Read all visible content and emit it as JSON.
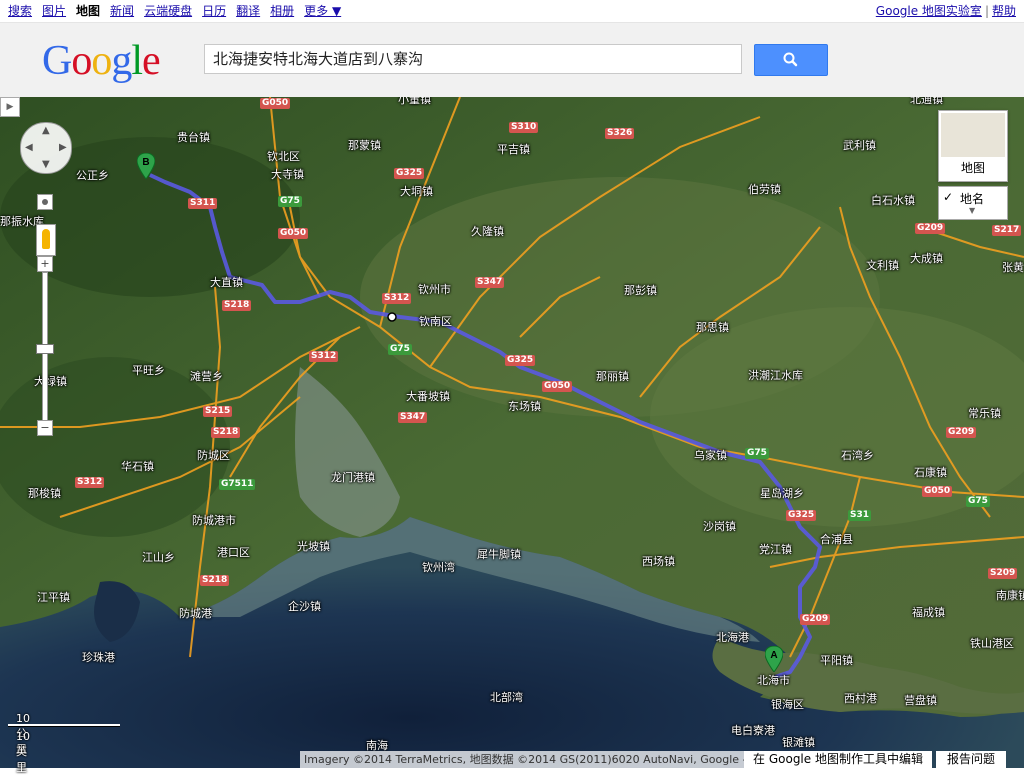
{
  "topbar": {
    "nav": [
      "搜索",
      "图片",
      "地图",
      "新闻",
      "云端硬盘",
      "日历",
      "翻译",
      "相册",
      "更多 ▼"
    ],
    "active_index": 2,
    "right_links": [
      "Google 地图实验室",
      "帮助"
    ]
  },
  "header": {
    "logo": {
      "letters": [
        "G",
        "o",
        "o",
        "g",
        "l",
        "e"
      ]
    },
    "search_value": "北海捷安特北海大道店到八寨沟",
    "search_icon": "search-icon"
  },
  "map": {
    "place_labels": [
      {
        "text": "贵台镇"
      },
      {
        "text": "公正乡"
      },
      {
        "text": "钦北区"
      },
      {
        "text": "大寺镇"
      },
      {
        "text": "那蒙镇"
      },
      {
        "text": "大垌镇"
      },
      {
        "text": "平吉镇"
      },
      {
        "text": "伯劳镇"
      },
      {
        "text": "武利镇"
      },
      {
        "text": "白石水镇"
      },
      {
        "text": "久隆镇"
      },
      {
        "text": "文利镇"
      },
      {
        "text": "大成镇"
      },
      {
        "text": "大直镇"
      },
      {
        "text": "钦州市"
      },
      {
        "text": "钦南区"
      },
      {
        "text": "那彭镇"
      },
      {
        "text": "那思镇"
      },
      {
        "text": "平旺乡"
      },
      {
        "text": "滩营乡"
      },
      {
        "text": "大绿镇"
      },
      {
        "text": "大番坡镇"
      },
      {
        "text": "那丽镇"
      },
      {
        "text": "洪潮江水库"
      },
      {
        "text": "东场镇"
      },
      {
        "text": "常乐镇"
      },
      {
        "text": "防城区"
      },
      {
        "text": "乌家镇"
      },
      {
        "text": "石湾乡"
      },
      {
        "text": "华石镇"
      },
      {
        "text": "龙门港镇"
      },
      {
        "text": "石康镇"
      },
      {
        "text": "那梭镇"
      },
      {
        "text": "星岛湖乡"
      },
      {
        "text": "防城港市"
      },
      {
        "text": "沙岗镇"
      },
      {
        "text": "合浦县"
      },
      {
        "text": "光坡镇"
      },
      {
        "text": "港口区"
      },
      {
        "text": "犀牛脚镇"
      },
      {
        "text": "党江镇"
      },
      {
        "text": "江山乡"
      },
      {
        "text": "钦州湾"
      },
      {
        "text": "西场镇"
      },
      {
        "text": "江平镇"
      },
      {
        "text": "防城港"
      },
      {
        "text": "企沙镇"
      },
      {
        "text": "福成镇"
      },
      {
        "text": "南康镇"
      },
      {
        "text": "北海港"
      },
      {
        "text": "铁山港区"
      },
      {
        "text": "珍珠港"
      },
      {
        "text": "平阳镇"
      },
      {
        "text": "北海市"
      },
      {
        "text": "西村港"
      },
      {
        "text": "营盘镇"
      },
      {
        "text": "北部湾"
      },
      {
        "text": "银海区"
      },
      {
        "text": "电白寮港"
      },
      {
        "text": "银滩镇"
      },
      {
        "text": "南海"
      },
      {
        "text": "那振水库"
      },
      {
        "text": "张黄"
      },
      {
        "text": "小董镇"
      },
      {
        "text": "北通镇"
      }
    ],
    "road_shields": [
      {
        "text": "G050",
        "kind": "s"
      },
      {
        "text": "S310",
        "kind": "s"
      },
      {
        "text": "S326",
        "kind": "s"
      },
      {
        "text": "G325",
        "kind": "s"
      },
      {
        "text": "S311",
        "kind": "s"
      },
      {
        "text": "G75",
        "kind": "g"
      },
      {
        "text": "G050",
        "kind": "s"
      },
      {
        "text": "S347",
        "kind": "s"
      },
      {
        "text": "S312",
        "kind": "s"
      },
      {
        "text": "S218",
        "kind": "s"
      },
      {
        "text": "G75",
        "kind": "g"
      },
      {
        "text": "G325",
        "kind": "s"
      },
      {
        "text": "S312",
        "kind": "s"
      },
      {
        "text": "G050",
        "kind": "s"
      },
      {
        "text": "S347",
        "kind": "s"
      },
      {
        "text": "S215",
        "kind": "s"
      },
      {
        "text": "S218",
        "kind": "s"
      },
      {
        "text": "G75",
        "kind": "g"
      },
      {
        "text": "G209",
        "kind": "s"
      },
      {
        "text": "S217",
        "kind": "s"
      },
      {
        "text": "G209",
        "kind": "s"
      },
      {
        "text": "G7511",
        "kind": "g"
      },
      {
        "text": "S312",
        "kind": "s"
      },
      {
        "text": "G050",
        "kind": "s"
      },
      {
        "text": "G75",
        "kind": "g"
      },
      {
        "text": "G325",
        "kind": "s"
      },
      {
        "text": "S31",
        "kind": "g"
      },
      {
        "text": "S218",
        "kind": "s"
      },
      {
        "text": "S209",
        "kind": "s"
      },
      {
        "text": "G209",
        "kind": "s"
      }
    ],
    "markers": {
      "start": "A",
      "end": "B"
    },
    "map_type": {
      "label": "地图"
    },
    "labels_toggle": {
      "check": "✓",
      "label": "地名"
    },
    "scale": {
      "metric": "10 公里",
      "imperial": "10 英里"
    },
    "copyright": "Imagery ©2014 TerraMetrics, 地图数据 ©2014 GS(2011)6020 AutoNavi, Google -",
    "edit_link": "在 Google 地图制作工具中编辑",
    "report_link": "报告问题",
    "zoom": {
      "in": "+",
      "out": "−"
    },
    "colors": {
      "route": "#5a5ae0",
      "highway": "#f0a020",
      "land": "#3f5f2a",
      "sea": "#1e3550",
      "ocean_deep": "#15263d",
      "shallow": "#7a8a7a"
    }
  }
}
